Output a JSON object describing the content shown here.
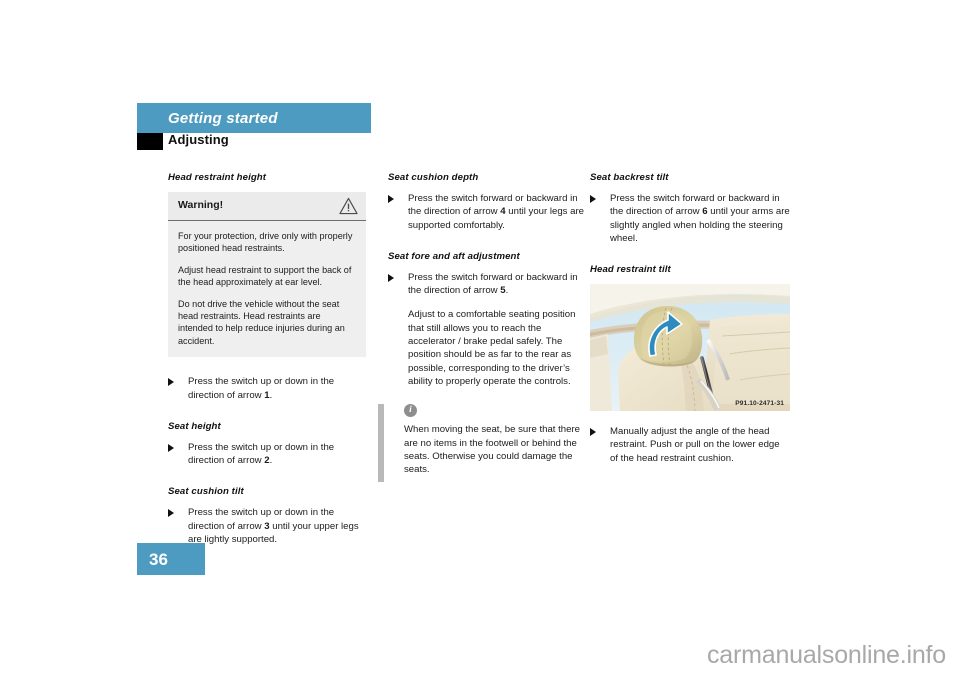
{
  "header": {
    "chapter_title": "Getting started",
    "section_title": "Adjusting",
    "bar_color": "#4e9bc1"
  },
  "columns": {
    "left": {
      "heading_1": "Head restraint height",
      "warning": {
        "label": "Warning!",
        "icon": "warning-triangle-icon",
        "paragraphs": [
          "For your protection, drive only with properly positioned head restraints.",
          "Adjust head restraint to support the back of the head approximately at ear level.",
          "Do not drive the vehicle without the seat head restraints. Head restraints are intended to help reduce injuries during an accident."
        ]
      },
      "bullet_1_pre": "Press the switch up or down in the direction of arrow ",
      "bullet_1_num": "1",
      "bullet_1_post": ".",
      "heading_2": "Seat height",
      "bullet_2_pre": "Press the switch up or down in the direction of arrow ",
      "bullet_2_num": "2",
      "bullet_2_post": ".",
      "heading_3": "Seat cushion tilt",
      "bullet_3_pre": "Press the switch up or down in the direction of arrow ",
      "bullet_3_num": "3",
      "bullet_3_post": " until your upper legs are lightly supported."
    },
    "middle": {
      "heading_1": "Seat cushion depth",
      "bullet_1_pre": "Press the switch forward or backward in the direction of arrow ",
      "bullet_1_num": "4",
      "bullet_1_post": " until your legs are supported comfortably.",
      "heading_2": "Seat fore and aft adjustment",
      "bullet_2_pre": "Press the switch forward or backward in the direction of arrow ",
      "bullet_2_num": "5",
      "bullet_2_post": ".",
      "paragraph": "Adjust to a comfortable seating position that still allows you to reach the accelerator / brake pedal safely. The position should be as far to the rear as possible, corresponding to the driver’s ability to properly operate the controls.",
      "note": {
        "icon": "info-icon",
        "icon_glyph": "i",
        "text": "When moving the seat, be sure that there are no items in the footwell or behind the seats. Otherwise you could damage the seats."
      }
    },
    "right": {
      "heading_1": "Seat backrest tilt",
      "bullet_1_pre": "Press the switch forward or backward in the direction of arrow ",
      "bullet_1_num": "6",
      "bullet_1_post": " until your arms are slightly angled when holding the steering wheel.",
      "heading_2": "Head restraint tilt",
      "figure": {
        "name": "head-restraint-tilt-illustration",
        "caption": "P91.10-2471-31",
        "arrow_color": "#2e8bbd"
      },
      "bullet_2_pre": "Manually adjust the angle of the head restraint. Push or pull on the lower edge of the head restraint cushion.",
      "bullet_2_num": "",
      "bullet_2_post": ""
    }
  },
  "footer": {
    "page_number": "36",
    "watermark": "carmanualsonline.info"
  }
}
